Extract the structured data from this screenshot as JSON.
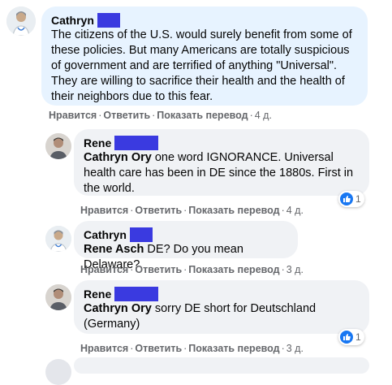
{
  "comments": [
    {
      "author": "Cathryn",
      "mention": "",
      "text": "The citizens of the U.S. would surely benefit from some of these policies. But many Americans are totally suspicious of government and are terrified of anything \"Universal\". They are willing to sacrifice their health and the health of their neighbors due to this fear.",
      "actions": {
        "like": "Нравится",
        "reply": "Ответить",
        "translate": "Показать перевод",
        "time": "4 д."
      },
      "reaction_count": ""
    },
    {
      "author": "Rene",
      "mention": "Cathryn Ory",
      "text": " one word IGNORANCE. Universal health care has been in DE since the 1880s. First in the world.",
      "actions": {
        "like": "Нравится",
        "reply": "Ответить",
        "translate": "Показать перевод",
        "time": "4 д."
      },
      "reaction_count": "1"
    },
    {
      "author": "Cathryn",
      "mention": "Rene Asch",
      "text": " DE? Do you mean Delaware?",
      "actions": {
        "like": "Нравится",
        "reply": "Ответить",
        "translate": "Показать перевод",
        "time": "3 д."
      },
      "reaction_count": ""
    },
    {
      "author": "Rene",
      "mention": "Cathryn Ory",
      "text": " sorry DE short for Deutschland (Germany)",
      "actions": {
        "like": "Нравится",
        "reply": "Ответить",
        "translate": "Показать перевод",
        "time": "3 д."
      },
      "reaction_count": "1"
    }
  ],
  "separator": "·",
  "colors": {
    "redaction": "#3a3ae0",
    "like_blue": "#1877f2",
    "bubble": "#f0f2f5",
    "bubble_main": "#e7f3ff"
  }
}
